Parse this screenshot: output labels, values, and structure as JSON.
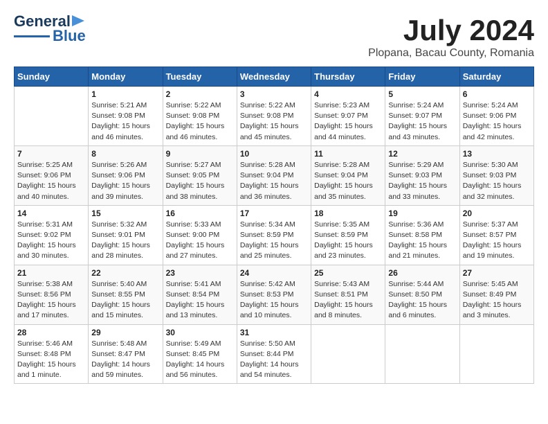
{
  "header": {
    "logo_general": "General",
    "logo_blue": "Blue",
    "title": "July 2024",
    "subtitle": "Plopana, Bacau County, Romania"
  },
  "calendar": {
    "weekdays": [
      "Sunday",
      "Monday",
      "Tuesday",
      "Wednesday",
      "Thursday",
      "Friday",
      "Saturday"
    ],
    "weeks": [
      [
        {
          "day": "",
          "content": ""
        },
        {
          "day": "1",
          "content": "Sunrise: 5:21 AM\nSunset: 9:08 PM\nDaylight: 15 hours\nand 46 minutes."
        },
        {
          "day": "2",
          "content": "Sunrise: 5:22 AM\nSunset: 9:08 PM\nDaylight: 15 hours\nand 46 minutes."
        },
        {
          "day": "3",
          "content": "Sunrise: 5:22 AM\nSunset: 9:08 PM\nDaylight: 15 hours\nand 45 minutes."
        },
        {
          "day": "4",
          "content": "Sunrise: 5:23 AM\nSunset: 9:07 PM\nDaylight: 15 hours\nand 44 minutes."
        },
        {
          "day": "5",
          "content": "Sunrise: 5:24 AM\nSunset: 9:07 PM\nDaylight: 15 hours\nand 43 minutes."
        },
        {
          "day": "6",
          "content": "Sunrise: 5:24 AM\nSunset: 9:06 PM\nDaylight: 15 hours\nand 42 minutes."
        }
      ],
      [
        {
          "day": "7",
          "content": "Sunrise: 5:25 AM\nSunset: 9:06 PM\nDaylight: 15 hours\nand 40 minutes."
        },
        {
          "day": "8",
          "content": "Sunrise: 5:26 AM\nSunset: 9:06 PM\nDaylight: 15 hours\nand 39 minutes."
        },
        {
          "day": "9",
          "content": "Sunrise: 5:27 AM\nSunset: 9:05 PM\nDaylight: 15 hours\nand 38 minutes."
        },
        {
          "day": "10",
          "content": "Sunrise: 5:28 AM\nSunset: 9:04 PM\nDaylight: 15 hours\nand 36 minutes."
        },
        {
          "day": "11",
          "content": "Sunrise: 5:28 AM\nSunset: 9:04 PM\nDaylight: 15 hours\nand 35 minutes."
        },
        {
          "day": "12",
          "content": "Sunrise: 5:29 AM\nSunset: 9:03 PM\nDaylight: 15 hours\nand 33 minutes."
        },
        {
          "day": "13",
          "content": "Sunrise: 5:30 AM\nSunset: 9:03 PM\nDaylight: 15 hours\nand 32 minutes."
        }
      ],
      [
        {
          "day": "14",
          "content": "Sunrise: 5:31 AM\nSunset: 9:02 PM\nDaylight: 15 hours\nand 30 minutes."
        },
        {
          "day": "15",
          "content": "Sunrise: 5:32 AM\nSunset: 9:01 PM\nDaylight: 15 hours\nand 28 minutes."
        },
        {
          "day": "16",
          "content": "Sunrise: 5:33 AM\nSunset: 9:00 PM\nDaylight: 15 hours\nand 27 minutes."
        },
        {
          "day": "17",
          "content": "Sunrise: 5:34 AM\nSunset: 8:59 PM\nDaylight: 15 hours\nand 25 minutes."
        },
        {
          "day": "18",
          "content": "Sunrise: 5:35 AM\nSunset: 8:59 PM\nDaylight: 15 hours\nand 23 minutes."
        },
        {
          "day": "19",
          "content": "Sunrise: 5:36 AM\nSunset: 8:58 PM\nDaylight: 15 hours\nand 21 minutes."
        },
        {
          "day": "20",
          "content": "Sunrise: 5:37 AM\nSunset: 8:57 PM\nDaylight: 15 hours\nand 19 minutes."
        }
      ],
      [
        {
          "day": "21",
          "content": "Sunrise: 5:38 AM\nSunset: 8:56 PM\nDaylight: 15 hours\nand 17 minutes."
        },
        {
          "day": "22",
          "content": "Sunrise: 5:40 AM\nSunset: 8:55 PM\nDaylight: 15 hours\nand 15 minutes."
        },
        {
          "day": "23",
          "content": "Sunrise: 5:41 AM\nSunset: 8:54 PM\nDaylight: 15 hours\nand 13 minutes."
        },
        {
          "day": "24",
          "content": "Sunrise: 5:42 AM\nSunset: 8:53 PM\nDaylight: 15 hours\nand 10 minutes."
        },
        {
          "day": "25",
          "content": "Sunrise: 5:43 AM\nSunset: 8:51 PM\nDaylight: 15 hours\nand 8 minutes."
        },
        {
          "day": "26",
          "content": "Sunrise: 5:44 AM\nSunset: 8:50 PM\nDaylight: 15 hours\nand 6 minutes."
        },
        {
          "day": "27",
          "content": "Sunrise: 5:45 AM\nSunset: 8:49 PM\nDaylight: 15 hours\nand 3 minutes."
        }
      ],
      [
        {
          "day": "28",
          "content": "Sunrise: 5:46 AM\nSunset: 8:48 PM\nDaylight: 15 hours\nand 1 minute."
        },
        {
          "day": "29",
          "content": "Sunrise: 5:48 AM\nSunset: 8:47 PM\nDaylight: 14 hours\nand 59 minutes."
        },
        {
          "day": "30",
          "content": "Sunrise: 5:49 AM\nSunset: 8:45 PM\nDaylight: 14 hours\nand 56 minutes."
        },
        {
          "day": "31",
          "content": "Sunrise: 5:50 AM\nSunset: 8:44 PM\nDaylight: 14 hours\nand 54 minutes."
        },
        {
          "day": "",
          "content": ""
        },
        {
          "day": "",
          "content": ""
        },
        {
          "day": "",
          "content": ""
        }
      ]
    ]
  }
}
